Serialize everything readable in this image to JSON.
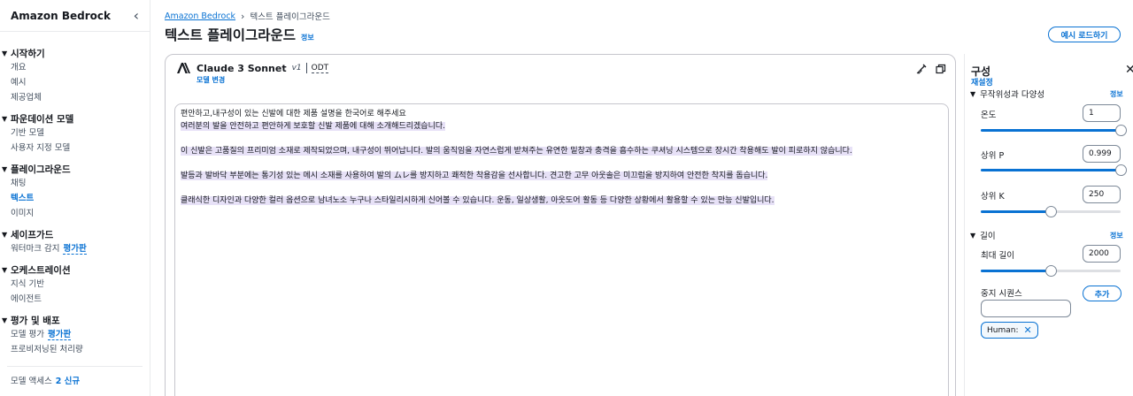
{
  "sidebar": {
    "title": "Amazon Bedrock",
    "groups": [
      {
        "title": "시작하기",
        "items": [
          {
            "label": "개요"
          },
          {
            "label": "예시"
          },
          {
            "label": "제공업체"
          }
        ]
      },
      {
        "title": "파운데이션 모델",
        "items": [
          {
            "label": "기반 모델"
          },
          {
            "label": "사용자 지정 모델"
          }
        ]
      },
      {
        "title": "플레이그라운드",
        "items": [
          {
            "label": "채팅"
          },
          {
            "label": "텍스트"
          },
          {
            "label": "이미지"
          }
        ]
      },
      {
        "title": "세이프가드",
        "items": [
          {
            "label": "워터마크 감지",
            "badge": "평가판"
          }
        ]
      },
      {
        "title": "오케스트레이션",
        "items": [
          {
            "label": "지식 기반"
          },
          {
            "label": "에이전트"
          }
        ]
      },
      {
        "title": "평가 및 배포",
        "items": [
          {
            "label": "모델 평가",
            "badge": "평가판"
          },
          {
            "label": "프로비저닝된 처리량"
          }
        ]
      }
    ],
    "footer": {
      "label": "모델 액세스",
      "badge": "2 신규"
    }
  },
  "breadcrumb": {
    "root": "Amazon Bedrock",
    "current": "텍스트 플레이그라운드"
  },
  "page": {
    "title": "텍스트 플레이그라운드",
    "info": "정보",
    "load_button": "예시 로드하기"
  },
  "model": {
    "name": "Claude 3 Sonnet",
    "version": "v1",
    "mode": "ODT",
    "change_label": "모델 변경"
  },
  "chat": {
    "prompt": "편안하고,내구성이 있는 신발에 대한 제품 설명을 한국어로 해주세요",
    "response": [
      "여러분의 발을 안전하고 편안하게 보호할 신발 제품에 대해 소개해드리겠습니다.",
      "이 신발은 고품질의 프리미엄 소재로 제작되었으며, 내구성이 뛰어납니다. 발의 움직임을 자연스럽게 받쳐주는 유연한 밑창과 충격을 흡수하는 쿠셔닝 시스템으로 장시간 착용해도 발이 피로하지 않습니다.",
      "발등과 발바닥 부분에는 통기성 있는 메시 소재를 사용하여 발의 ムレ를 방지하고 쾌적한 착용감을 선사합니다. 견고한 고무 아웃솔은 미끄럼을 방지하여 안전한 착지를 돕습니다.",
      "클래식한 디자인과 다양한 컬러 옵션으로 남녀노소 누구나 스타일리시하게 신어볼 수 있습니다. 운동, 일상생활, 아웃도어 활동 등 다양한 상황에서 활용할 수 있는 만능 신발입니다."
    ]
  },
  "config": {
    "title": "구성",
    "reset": "재설정",
    "randomness_section": "무작위성과 다양성",
    "length_section": "길이",
    "info": "정보",
    "temperature": {
      "label": "온도",
      "value": "1",
      "fraction": 1.0
    },
    "top_p": {
      "label": "상위 P",
      "value": "0.999",
      "fraction": 0.999
    },
    "top_k": {
      "label": "상위 K",
      "value": "250",
      "fraction": 0.5
    },
    "max_length": {
      "label": "최대 길이",
      "value": "2000",
      "fraction": 0.5
    },
    "stop_sequences": {
      "label": "중지 시퀀스",
      "add_label": "추가",
      "tokens": [
        "Human:"
      ]
    }
  }
}
